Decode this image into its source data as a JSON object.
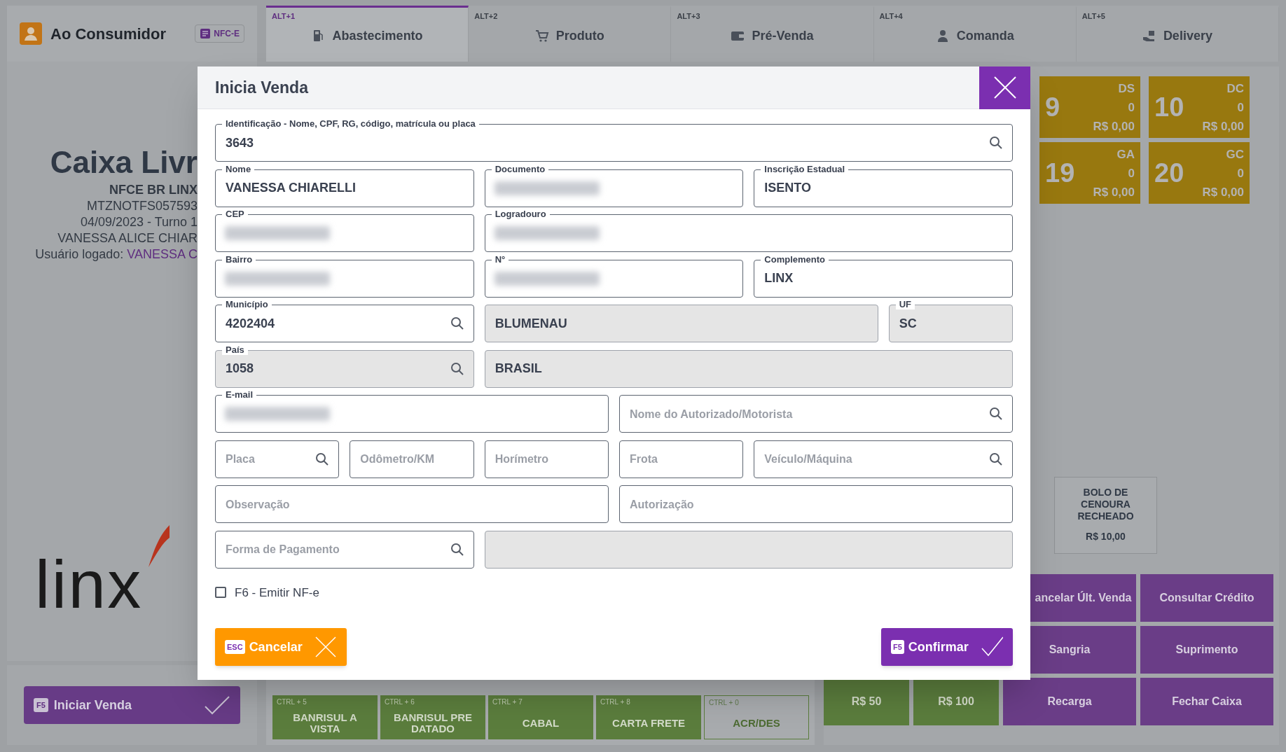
{
  "customer_header": {
    "title": "Ao Consumidor",
    "badge": "NFC-E"
  },
  "tabs": [
    {
      "shortcut": "ALT+1",
      "label": "Abastecimento",
      "selected": true
    },
    {
      "shortcut": "ALT+2",
      "label": "Produto",
      "selected": false
    },
    {
      "shortcut": "ALT+3",
      "label": "Pré-Venda",
      "selected": false
    },
    {
      "shortcut": "ALT+4",
      "label": "Comanda",
      "selected": false
    },
    {
      "shortcut": "ALT+5",
      "label": "Delivery",
      "selected": false
    }
  ],
  "status_panel": {
    "title": "Caixa Livr",
    "pos_name": "NFCE BR LINX",
    "terminal": "MTZNOTFS057593",
    "date_shift": "04/09/2023 - Turno 1",
    "operator": "VANESSA ALICE CHIAR",
    "user_label": "Usuário logado:",
    "user_value": "VANESSA C"
  },
  "logo_text": "linx",
  "start_sale_button": {
    "key": "F5",
    "label": "Iniciar Venda"
  },
  "pump_tiles": [
    {
      "number": "9",
      "code": "DS",
      "quantity": "0",
      "amount": "R$ 0,00"
    },
    {
      "number": "10",
      "code": "DC",
      "quantity": "0",
      "amount": "R$ 0,00"
    },
    {
      "number": "19",
      "code": "GA",
      "quantity": "0",
      "amount": "R$ 0,00"
    },
    {
      "number": "20",
      "code": "GC",
      "quantity": "0",
      "amount": "R$ 0,00"
    }
  ],
  "product_card": {
    "name": "BOLO DE CENOURA RECHEADO",
    "price": "R$ 10,00"
  },
  "action_buttons": [
    {
      "label": "ancelar Últ. Venda",
      "kind": "purple"
    },
    {
      "label": "Consultar Crédito",
      "kind": "purple"
    },
    {
      "label": "Sangria",
      "kind": "purple"
    },
    {
      "label": "Suprimento",
      "kind": "purple"
    },
    {
      "label": "R$ 50",
      "kind": "green"
    },
    {
      "label": "R$ 100",
      "kind": "green"
    },
    {
      "label": "Recarga",
      "kind": "purple"
    },
    {
      "label": "Fechar Caixa",
      "kind": "purple"
    }
  ],
  "payment_buttons": [
    {
      "shortcut": "CTRL + 5",
      "label": "BANRISUL A VISTA",
      "kind": "filled"
    },
    {
      "shortcut": "CTRL + 6",
      "label": "BANRISUL PRE DATADO",
      "kind": "filled"
    },
    {
      "shortcut": "CTRL + 7",
      "label": "CABAL",
      "kind": "filled"
    },
    {
      "shortcut": "CTRL + 8",
      "label": "CARTA FRETE",
      "kind": "filled"
    },
    {
      "shortcut": "CTRL + 0",
      "label": "ACR/DES",
      "kind": "outlined"
    }
  ],
  "dialog": {
    "title": "Inicia Venda",
    "fields": [
      {
        "label": "Identificação - Nome, CPF, RG, código, matrícula ou placa",
        "value": "3643",
        "search": true
      },
      {
        "label": "Nome",
        "value": "VANESSA CHIARELLI"
      },
      {
        "label": "Documento",
        "redacted": true
      },
      {
        "label": "Inscrição Estadual",
        "value": "ISENTO"
      },
      {
        "label": "CEP",
        "redacted": true
      },
      {
        "label": "Logradouro",
        "redacted": true
      },
      {
        "label": "Bairro",
        "redacted": true
      },
      {
        "label": "N°",
        "redacted": true
      },
      {
        "label": "Complemento",
        "value": "LINX"
      },
      {
        "label": "Município",
        "value": "4202404",
        "search": true
      },
      {
        "value": "BLUMENAU",
        "readonly": true
      },
      {
        "label": "UF",
        "value": "SC",
        "readonly": true
      },
      {
        "label": "País",
        "value": "1058",
        "readonly": true,
        "search": true
      },
      {
        "value": "BRASIL",
        "readonly": true
      },
      {
        "label": "E-mail",
        "redacted": true
      },
      {
        "placeholder": "Nome do Autorizado/Motorista",
        "search": true
      },
      {
        "placeholder": "Placa",
        "search": true
      },
      {
        "placeholder": "Odômetro/KM"
      },
      {
        "placeholder": "Horímetro"
      },
      {
        "placeholder": "Frota"
      },
      {
        "placeholder": "Veículo/Máquina",
        "search": true
      },
      {
        "placeholder": "Observação"
      },
      {
        "placeholder": "Autorização"
      },
      {
        "placeholder": "Forma de Pagamento",
        "search": true
      },
      {
        "readonly": true
      }
    ],
    "checkbox": {
      "label": "F6 - Emitir NF-e",
      "checked": false
    },
    "buttons": [
      {
        "key": "ESC",
        "label": "Cancelar",
        "kind": "cancel"
      },
      {
        "key": "F5",
        "label": "Confirmar",
        "kind": "confirm"
      }
    ]
  }
}
